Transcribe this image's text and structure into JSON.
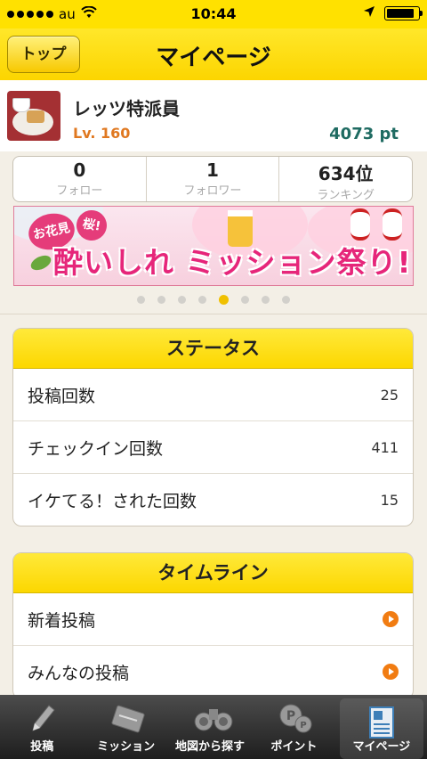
{
  "status_bar": {
    "carrier": "au",
    "time": "10:44",
    "battery_level": 0.9
  },
  "nav": {
    "back_label": "トップ",
    "title": "マイページ"
  },
  "profile": {
    "name": "レッツ特派員",
    "level": "Lv. 160",
    "points": "4073 pt"
  },
  "stats": [
    {
      "value": "0",
      "label": "フォロー"
    },
    {
      "value": "1",
      "label": "フォロワー"
    },
    {
      "value": "634位",
      "label": "ランキング"
    }
  ],
  "banner": {
    "tag1": "お花見",
    "tag2": "桜!",
    "text": "酔いしれ  ミッション祭り!"
  },
  "pager": {
    "count": 8,
    "active_index": 4
  },
  "status_card": {
    "title": "ステータス",
    "rows": [
      {
        "label": "投稿回数",
        "value": "25"
      },
      {
        "label": "チェックイン回数",
        "value": "411"
      },
      {
        "label": "イケてる！された回数",
        "value": "15"
      }
    ]
  },
  "timeline_card": {
    "title": "タイムライン",
    "rows": [
      {
        "label": "新着投稿"
      },
      {
        "label": "みんなの投稿"
      }
    ]
  },
  "tabs": [
    {
      "label": "投稿",
      "icon": "pencil-icon"
    },
    {
      "label": "ミッション",
      "icon": "mission-icon"
    },
    {
      "label": "地図から探す",
      "icon": "binoculars-icon"
    },
    {
      "label": "ポイント",
      "icon": "points-coin-icon"
    },
    {
      "label": "マイページ",
      "icon": "mypage-profile-icon",
      "active": true
    }
  ]
}
